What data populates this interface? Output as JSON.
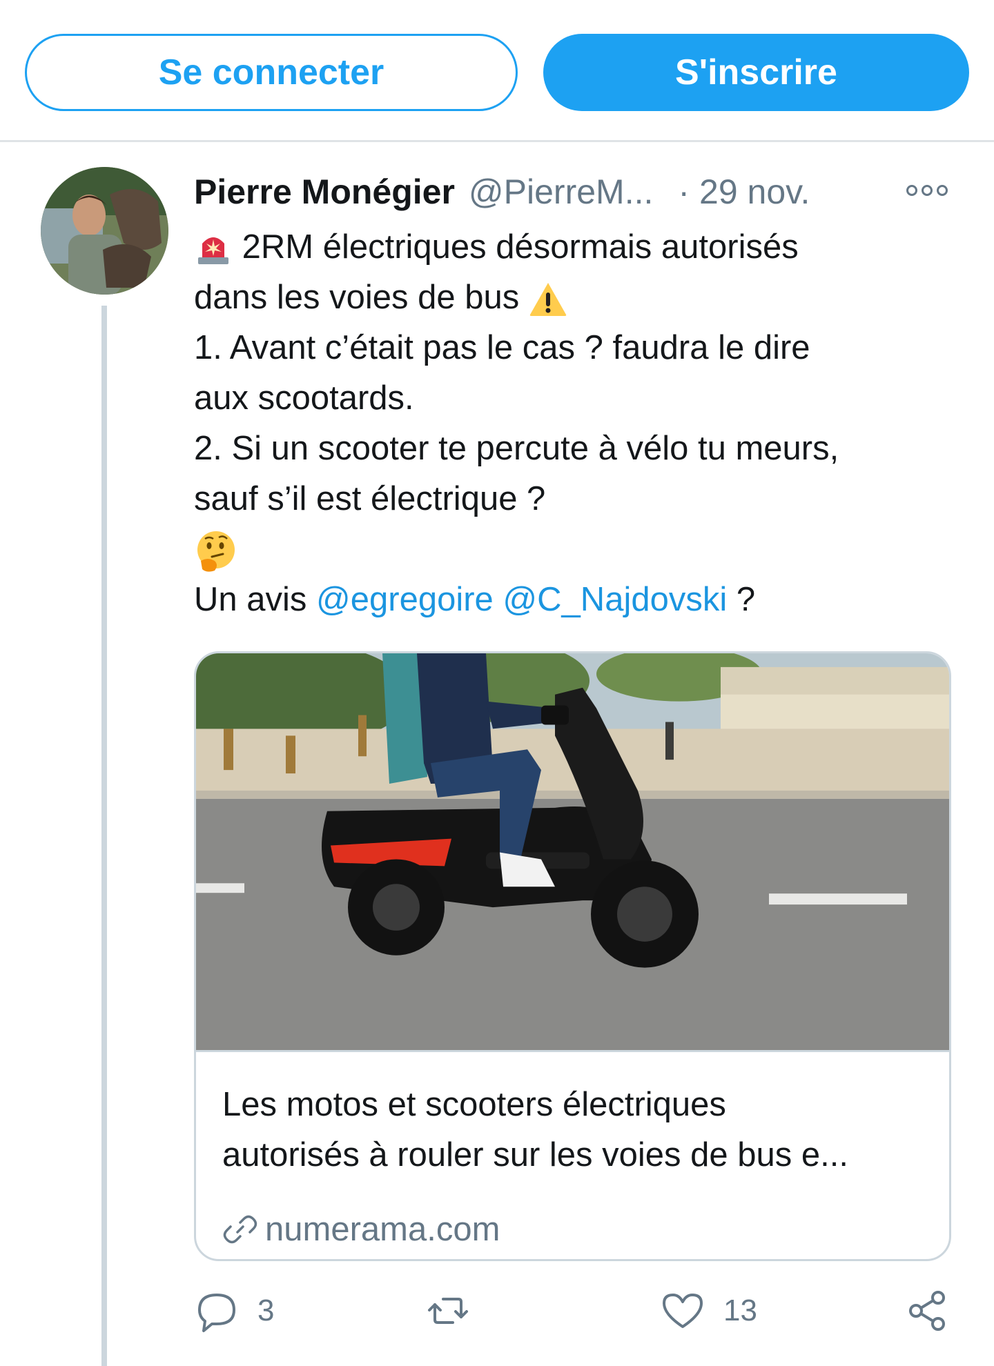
{
  "auth": {
    "login_label": "Se connecter",
    "signup_label": "S'inscrire"
  },
  "tweet": {
    "author_name": "Pierre Monégier",
    "author_handle": "@PierreM...",
    "separator": "·",
    "date": "29 nov.",
    "lines": {
      "l1": "2RM électriques désormais autorisés",
      "l2": "dans les voies de bus",
      "l3": "1. Avant c’était pas le cas ? faudra le dire",
      "l4": "aux scootards.",
      "l5": "2. Si un scooter te percute à vélo tu meurs,",
      "l6": "sauf s’il est électrique ?",
      "l8_prefix": "Un avis",
      "mention1": "@egregoire",
      "mention2": "@C_Najdovski",
      "l8_suffix": "?"
    },
    "emojis": [
      "police-light-emoji",
      "warning-emoji",
      "thinking-face-emoji"
    ]
  },
  "card": {
    "title_line1": "Les motos et scooters électriques",
    "title_line2": "autorisés à rouler sur les voies de bus e...",
    "domain": "numerama.com",
    "image": "electric-scooter-photo"
  },
  "actions": {
    "reply_count": "3",
    "like_count": "13",
    "icons": [
      "reply-icon",
      "retweet-icon",
      "like-icon",
      "share-icon"
    ]
  },
  "colors": {
    "accent": "#1da1f2",
    "mention": "#1b95e0",
    "secondary_text": "#657786",
    "border": "#ccd6dd"
  }
}
